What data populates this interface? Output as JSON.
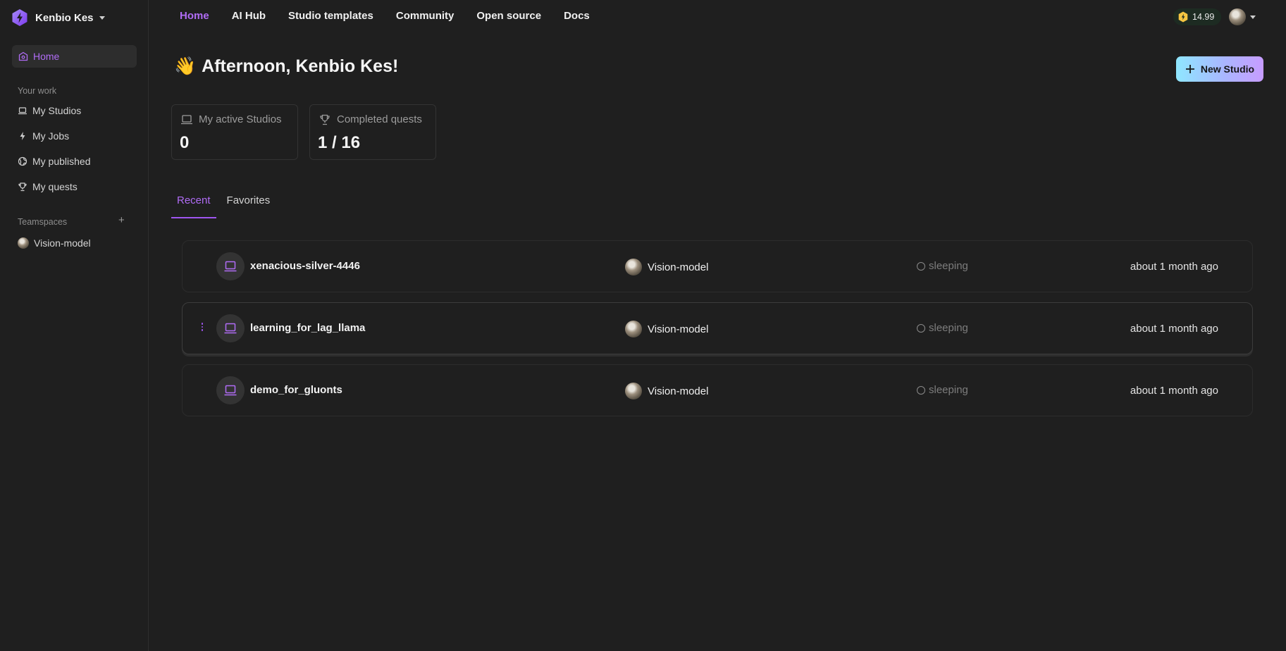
{
  "brand": {
    "name": "Kenbio Kes"
  },
  "sidebar": {
    "home_label": "Home",
    "your_work_label": "Your work",
    "items": [
      {
        "label": "My Studios",
        "icon": "laptop-icon"
      },
      {
        "label": "My Jobs",
        "icon": "bolt-icon"
      },
      {
        "label": "My published",
        "icon": "globe-icon"
      },
      {
        "label": "My quests",
        "icon": "trophy-icon"
      }
    ],
    "teamspaces_label": "Teamspaces",
    "add_label": "+",
    "teamspaces": [
      {
        "label": "Vision-model"
      }
    ]
  },
  "nav": {
    "items": [
      "Home",
      "AI Hub",
      "Studio templates",
      "Community",
      "Open source",
      "Docs"
    ],
    "active": "Home"
  },
  "credits": {
    "value": "14.99"
  },
  "greeting": {
    "emoji": "👋",
    "text": "Afternoon, Kenbio Kes!"
  },
  "new_studio_label": "New Studio",
  "stats": [
    {
      "label": "My active Studios",
      "value": "0",
      "icon": "laptop-icon"
    },
    {
      "label": "Completed quests",
      "value": "1 / 16",
      "icon": "trophy-icon"
    }
  ],
  "tabs": {
    "items": [
      "Recent",
      "Favorites"
    ],
    "active": "Recent"
  },
  "studios": [
    {
      "name": "xenacious-silver-4446",
      "teamspace": "Vision-model",
      "status": "sleeping",
      "time": "about 1 month ago"
    },
    {
      "name": "learning_for_lag_llama",
      "teamspace": "Vision-model",
      "status": "sleeping",
      "time": "about 1 month ago"
    },
    {
      "name": "demo_for_gluonts",
      "teamspace": "Vision-model",
      "status": "sleeping",
      "time": "about 1 month ago"
    }
  ],
  "colors": {
    "accent": "#b06cf5",
    "background": "#1f1f1f",
    "credits_bg": "#1d2b22"
  }
}
